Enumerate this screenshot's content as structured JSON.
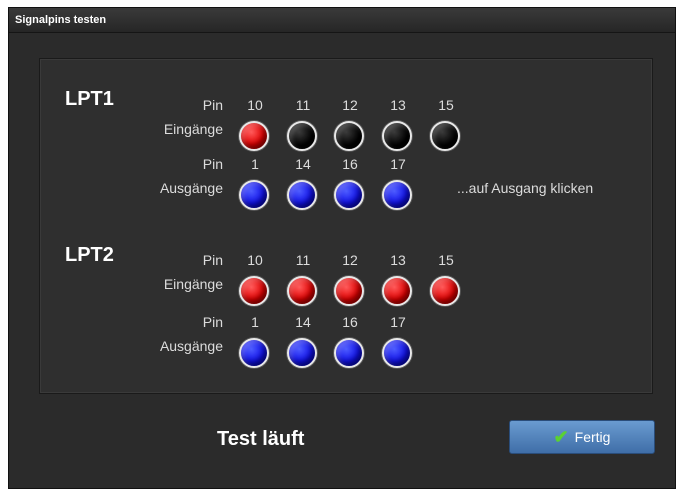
{
  "window": {
    "title": "Signalpins testen"
  },
  "lpt1": {
    "title": "LPT1",
    "pin_label": "Pin",
    "inputs_label": "Eingänge",
    "outputs_label": "Ausgänge",
    "input_pins": [
      "10",
      "11",
      "12",
      "13",
      "15"
    ],
    "input_states": [
      "red",
      "black",
      "black",
      "black",
      "black"
    ],
    "output_pins": [
      "1",
      "14",
      "16",
      "17"
    ],
    "hint": "...auf Ausgang klicken"
  },
  "lpt2": {
    "title": "LPT2",
    "pin_label": "Pin",
    "inputs_label": "Eingänge",
    "outputs_label": "Ausgänge",
    "input_pins": [
      "10",
      "11",
      "12",
      "13",
      "15"
    ],
    "input_states": [
      "red",
      "red",
      "red",
      "red",
      "red"
    ],
    "output_pins": [
      "1",
      "14",
      "16",
      "17"
    ]
  },
  "status": "Test läuft",
  "finish_button": {
    "label": "Fertig"
  },
  "colors": {
    "active_input": "#e00000",
    "inactive_input": "#000000",
    "output": "#1010e8"
  }
}
